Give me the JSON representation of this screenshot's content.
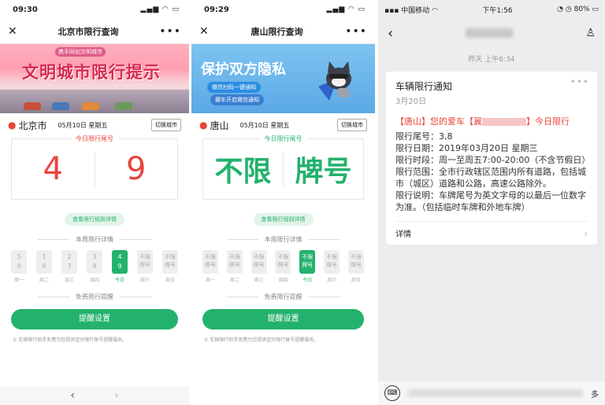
{
  "p1": {
    "time": "09:30",
    "title": "北京市限行查询",
    "banner_top": "携手同创文明城市",
    "banner_main": "文明城市限行提示",
    "city": "北京市",
    "date": "05月10日  星期五",
    "switch": "切换城市",
    "today_label": "今日限行尾号",
    "digits": [
      "4",
      "9"
    ],
    "rules_link": "查看限行规则详情",
    "week_title": "本周限行详情",
    "days": [
      {
        "v": "5\n0",
        "l": "周一"
      },
      {
        "v": "1\n6",
        "l": "周二"
      },
      {
        "v": "2\n7",
        "l": "周三"
      },
      {
        "v": "3\n8",
        "l": "周四"
      },
      {
        "v": "4\n9",
        "l": "今日"
      },
      {
        "v": "不限\n牌号",
        "l": "周六"
      },
      {
        "v": "不限\n牌号",
        "l": "周日"
      }
    ],
    "free_title": "免费限行提醒",
    "remind_btn": "提醒设置",
    "note": "① 车辆限行助手免费为您提供定时限行尾号提醒服务。"
  },
  "p2": {
    "time": "09:29",
    "title": "唐山限行查询",
    "banner_main": "保护双方隐私",
    "banner_sub": "微信扫码一键通知",
    "banner_btn": "挪车开启微信通知",
    "city": "唐山",
    "date": "05月10日  星期五",
    "switch": "切换城市",
    "today_label": "今日限行尾号",
    "digits": [
      "不限",
      "牌号"
    ],
    "rules_link": "查看限行规则详情",
    "week_title": "本周限行详情",
    "days": [
      {
        "v": "不限\n牌号",
        "l": "周一"
      },
      {
        "v": "不限\n牌号",
        "l": "周二"
      },
      {
        "v": "不限\n牌号",
        "l": "周三"
      },
      {
        "v": "不限\n牌号",
        "l": "周四"
      },
      {
        "v": "不限\n牌号",
        "l": "今日"
      },
      {
        "v": "不限\n牌号",
        "l": "周六"
      },
      {
        "v": "不限\n牌号",
        "l": "周日"
      }
    ],
    "free_title": "免费限行提醒",
    "remind_btn": "提醒设置",
    "note": "① 车辆限行助手免费为您提供定时限行尾号提醒服务。"
  },
  "p3": {
    "carrier": "中国移动",
    "time": "下午1:56",
    "battery": "80%",
    "timestamp": "昨天 上午6:34",
    "card_title": "车辆限行通知",
    "card_date": "3月20日",
    "alert_pre": "【唐山】您的爱车【冀",
    "alert_post": "】今日限行",
    "lines": [
      "限行尾号：3,8",
      "限行日期：2019年03月20日 星期三",
      "限行时段：周一至周五7:00-20:00（不含节假日）",
      "限行范围：全市行政辖区范围内所有道路，包括城市（城区）道路和公路，高速公路除外。",
      "限行说明：车牌尾号为英文字母的以最后一位数字为准。（包括临时车牌和外地车牌）"
    ],
    "detail": "详情",
    "more_text": "多"
  }
}
